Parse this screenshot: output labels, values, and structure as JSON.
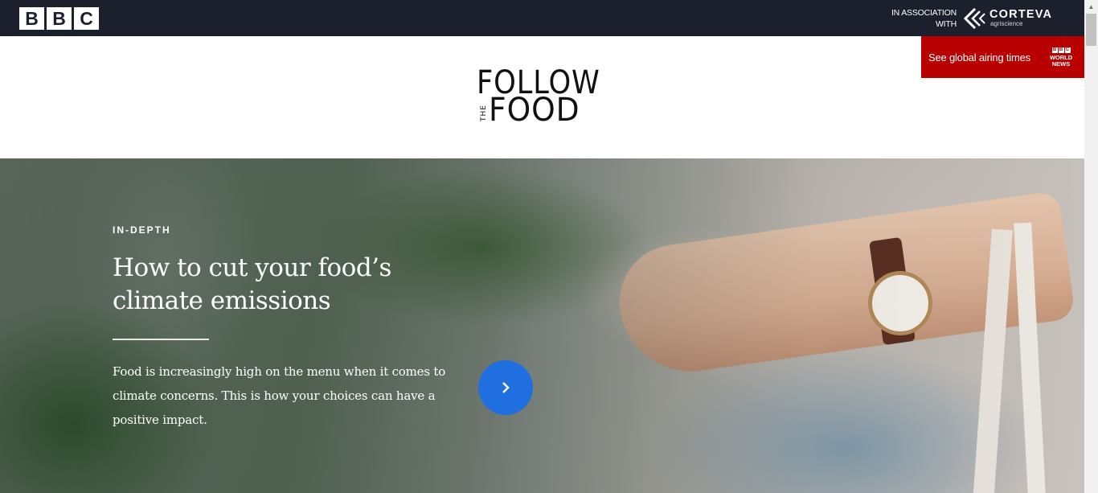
{
  "topbar": {
    "bbc_letters": [
      "B",
      "B",
      "C"
    ],
    "association_text": "IN ASSOCIATION WITH",
    "partner_name": "CORTEVA",
    "partner_sub": "agriscience"
  },
  "airing": {
    "label": "See global airing times",
    "channel_bbc": [
      "B",
      "B",
      "C"
    ],
    "channel_lines": [
      "WORLD",
      "NEWS"
    ]
  },
  "brand": {
    "line1": "FOLLOW",
    "the": "THE",
    "line2": "FOOD"
  },
  "hero": {
    "kicker": "IN-DEPTH",
    "headline": "How to cut your food’s climate emissions",
    "summary": "Food is increasingly high on the menu when it comes to climate concerns. This is how your choices can have a positive impact.",
    "next_icon": "chevron-right-icon"
  },
  "colors": {
    "topbar": "#1c202d",
    "airing_bg": "#b80000",
    "cta_blue": "#1f6fe0"
  }
}
